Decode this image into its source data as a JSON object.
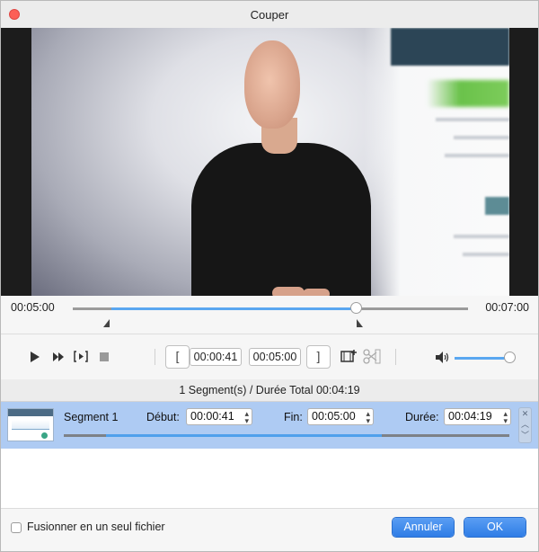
{
  "window": {
    "title": "Couper"
  },
  "timeline": {
    "start_time": "00:05:00",
    "end_time": "00:07:00",
    "selection_start": 0.1,
    "selection_end": 0.72,
    "playhead": 0.72
  },
  "toolbar": {
    "icons": [
      "play-icon",
      "fast-forward-icon",
      "play-selection-icon",
      "stop-icon",
      "set-start-bracket-icon",
      "set-end-bracket-icon",
      "add-segment-icon",
      "cut-icon",
      "volume-icon"
    ],
    "start_value": "00:00:41",
    "end_value": "00:05:00",
    "volume": 1.0
  },
  "summary": {
    "text": "1 Segment(s) / Durée Total 00:04:19"
  },
  "segment": {
    "name": "Segment 1",
    "start_label": "Début:",
    "start_value": "00:00:41",
    "end_label": "Fin:",
    "end_value": "00:05:00",
    "duration_label": "Durée:",
    "duration_value": "00:04:19"
  },
  "footer": {
    "merge_label": "Fusionner en un seul fichier",
    "merge_checked": false,
    "cancel_label": "Annuler",
    "ok_label": "OK"
  },
  "colors": {
    "accent": "#3b8ced",
    "selection_row": "#aecbf3",
    "close": "#fc5f57"
  }
}
